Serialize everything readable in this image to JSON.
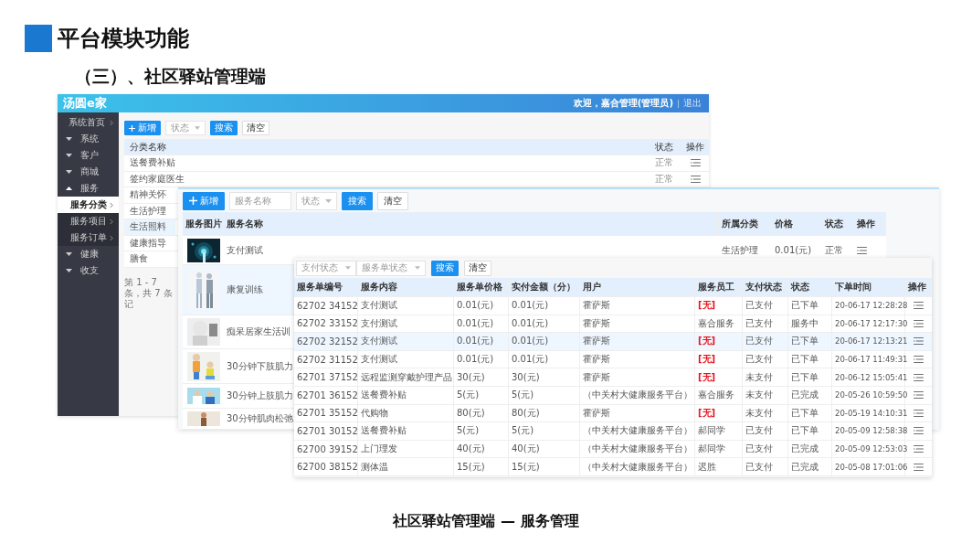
{
  "slide": {
    "title": "平台模块功能",
    "subtitle": "（三）、社区驿站管理端",
    "caption": "社区驿站管理端 — 服务管理"
  },
  "category_window": {
    "logo": "汤圆e家",
    "welcome": "欢迎，嘉合管理(管理员)",
    "logout": "退出",
    "sidebar": [
      {
        "label": "系统首页",
        "kind": "link"
      },
      {
        "label": "系统",
        "kind": "group",
        "expanded": false
      },
      {
        "label": "客户",
        "kind": "group",
        "expanded": false
      },
      {
        "label": "商城",
        "kind": "group",
        "expanded": false
      },
      {
        "label": "服务",
        "kind": "group",
        "expanded": true,
        "children": [
          {
            "label": "服务分类",
            "selected": true
          },
          {
            "label": "服务项目",
            "selected": false
          },
          {
            "label": "服务订单",
            "selected": false
          }
        ]
      },
      {
        "label": "健康",
        "kind": "group",
        "expanded": false
      },
      {
        "label": "收支",
        "kind": "group",
        "expanded": false
      }
    ],
    "toolbar": {
      "add": "新增",
      "status": "状态",
      "search": "搜索",
      "clear": "清空"
    },
    "columns": [
      "分类名称",
      "状态",
      "操作"
    ],
    "rows": [
      {
        "name": "送餐费补贴",
        "status": "正常",
        "selected": false
      },
      {
        "name": "签约家庭医生",
        "status": "正常",
        "selected": false
      },
      {
        "name": "精神关怀",
        "selected": false
      },
      {
        "name": "生活护理",
        "selected": false
      },
      {
        "name": "生活照料",
        "selected": true
      },
      {
        "name": "健康指导",
        "selected": false
      },
      {
        "name": "膳食",
        "selected": false
      }
    ],
    "pagination": "第 1 - 7 条，共 7 条记"
  },
  "service_window": {
    "toolbar": {
      "add": "新增",
      "name_placeholder": "服务名称",
      "status": "状态",
      "search": "搜索",
      "clear": "清空"
    },
    "columns": [
      "服务图片",
      "服务名称",
      "所属分类",
      "价格",
      "状态",
      "操作"
    ],
    "rows": [
      {
        "name": "支付测试",
        "category": "生活护理",
        "price": "0.01(元)",
        "status": "正常",
        "selected": false
      },
      {
        "name": "康复训练",
        "selected": true
      },
      {
        "name": "痴呆居家生活训",
        "selected": false
      },
      {
        "name": "30分钟下肢肌力",
        "selected": false
      },
      {
        "name": "30分钟上肢肌力",
        "selected": false
      },
      {
        "name": "30分钟肌肉松弛",
        "selected": false
      }
    ]
  },
  "order_window": {
    "filters": [
      "支付状态",
      "服务单状态"
    ],
    "search": "搜索",
    "clear": "清空",
    "columns": [
      "服务单编号",
      "服务内容",
      "服务单价格",
      "实付金额（分）",
      "用户",
      "服务员工",
      "支付状态",
      "状态",
      "下单时间",
      "操作"
    ],
    "rows": [
      {
        "id": "62702 34152",
        "content": "支付测试",
        "unit_price": "0.01(元)",
        "paid": "0.01(元)",
        "user": "霍萨斯",
        "staff": "[无]",
        "unassigned": true,
        "pay_status": "已支付",
        "status": "已下单",
        "time": "20-06-17 12:28:28",
        "selected": false
      },
      {
        "id": "62702 33152",
        "content": "支付测试",
        "unit_price": "0.01(元)",
        "paid": "0.01(元)",
        "user": "霍萨斯",
        "staff": "嘉合服务",
        "unassigned": false,
        "pay_status": "已支付",
        "status": "服务中",
        "time": "20-06-17 12:17:30",
        "selected": false
      },
      {
        "id": "62702 32152",
        "content": "支付测试",
        "unit_price": "0.01(元)",
        "paid": "0.01(元)",
        "user": "霍萨斯",
        "staff": "[无]",
        "unassigned": true,
        "pay_status": "已支付",
        "status": "已下单",
        "time": "20-06-17 12:13:21",
        "selected": true
      },
      {
        "id": "62702 31152",
        "content": "支付测试",
        "unit_price": "0.01(元)",
        "paid": "0.01(元)",
        "user": "霍萨斯",
        "staff": "[无]",
        "unassigned": true,
        "pay_status": "已支付",
        "status": "已下单",
        "time": "20-06-17 11:49:31",
        "selected": false
      },
      {
        "id": "62701 37152",
        "content": "远程监测穿戴护理产品",
        "unit_price": "30(元)",
        "paid": "30(元)",
        "user": "霍萨斯",
        "staff": "[无]",
        "unassigned": true,
        "pay_status": "未支付",
        "status": "已下单",
        "time": "20-06-12 15:05:41",
        "selected": false
      },
      {
        "id": "62701 36152",
        "content": "送餐费补贴",
        "unit_price": "5(元)",
        "paid": "5(元)",
        "user": "（中关村大健康服务平台）",
        "staff": "嘉合服务",
        "unassigned": false,
        "pay_status": "未支付",
        "status": "已完成",
        "time": "20-05-26 10:59:50",
        "selected": false
      },
      {
        "id": "62701 35152",
        "content": "代购物",
        "unit_price": "80(元)",
        "paid": "80(元)",
        "user": "霍萨斯",
        "staff": "[无]",
        "unassigned": true,
        "pay_status": "未支付",
        "status": "已下单",
        "time": "20-05-19 14:10:31",
        "selected": false
      },
      {
        "id": "62701 30152",
        "content": "送餐费补贴",
        "unit_price": "5(元)",
        "paid": "5(元)",
        "user": "（中关村大健康服务平台）",
        "staff": "郝同学",
        "unassigned": false,
        "pay_status": "已支付",
        "status": "已下单",
        "time": "20-05-09 12:58:38",
        "selected": false
      },
      {
        "id": "62700 39152",
        "content": "上门理发",
        "unit_price": "40(元)",
        "paid": "40(元)",
        "user": "（中关村大健康服务平台）",
        "staff": "郝同学",
        "unassigned": false,
        "pay_status": "已支付",
        "status": "已完成",
        "time": "20-05-09 12:53:03",
        "selected": false
      },
      {
        "id": "62700 38152",
        "content": "测体温",
        "unit_price": "15(元)",
        "paid": "15(元)",
        "user": "（中关村大健康服务平台）",
        "staff": "迟胜",
        "unassigned": false,
        "pay_status": "已支付",
        "status": "已完成",
        "time": "20-05-08 17:01:06",
        "selected": false
      }
    ]
  }
}
